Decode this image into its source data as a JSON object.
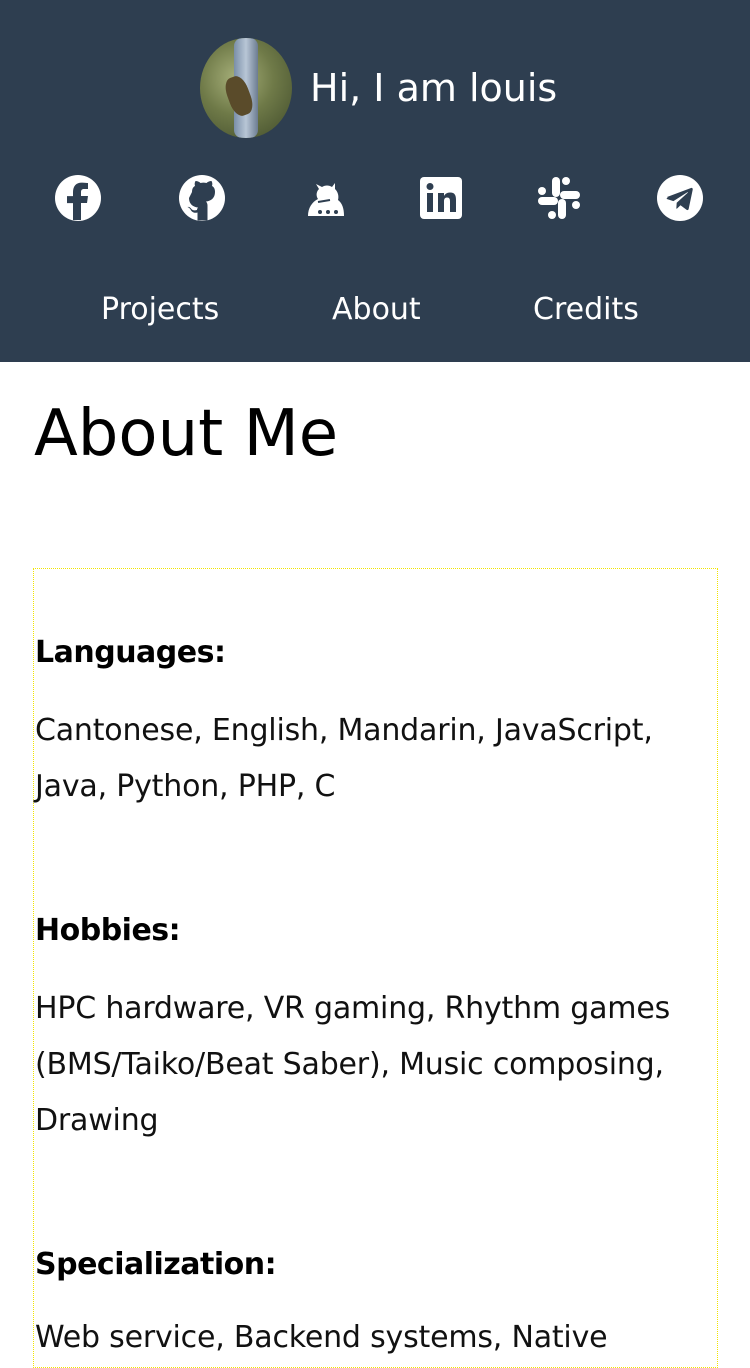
{
  "header": {
    "greeting": "Hi, I am louis",
    "avatar_alt": "profile photo of a bug on a tree trunk",
    "background": "#2e3e50",
    "social_icons": [
      {
        "name": "facebook-icon"
      },
      {
        "name": "github-icon"
      },
      {
        "name": "warframe-icon"
      },
      {
        "name": "linkedin-icon"
      },
      {
        "name": "slack-icon"
      },
      {
        "name": "telegram-icon"
      }
    ],
    "nav": {
      "projects": "Projects",
      "about": "About",
      "credits": "Credits"
    }
  },
  "main": {
    "title": "About Me",
    "sections": {
      "languages": {
        "heading": "Languages:",
        "body": "Cantonese, English, Mandarin, JavaScript, Java, Python, PHP, C"
      },
      "hobbies": {
        "heading": "Hobbies:",
        "body": "HPC hardware, VR gaming, Rhythm games (BMS/Taiko/Beat Saber), Music composing, Drawing"
      },
      "specialization": {
        "heading": "Specialization:",
        "body": "Web service, Backend systems, Native"
      }
    }
  },
  "colors": {
    "header_bg": "#2e3e50",
    "content_border": "#f2e600",
    "text": "#000000"
  }
}
